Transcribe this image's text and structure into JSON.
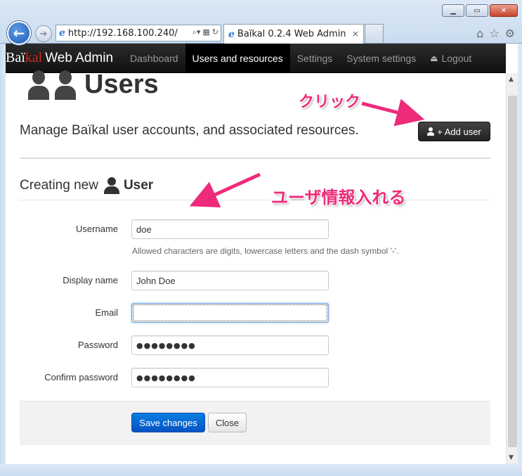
{
  "browser": {
    "address": "http://192.168.100.240/",
    "tab_title": "Baïkal 0.2.4 Web Admin",
    "tab_close": "×"
  },
  "navbar": {
    "brand_prefix": "Baï",
    "brand_accent": "kal",
    "brand_suffix": "Web Admin",
    "items": [
      {
        "label": "Dashboard",
        "active": false
      },
      {
        "label": "Users and resources",
        "active": true
      },
      {
        "label": "Settings",
        "active": false
      },
      {
        "label": "System settings",
        "active": false
      },
      {
        "label": "Logout",
        "active": false
      }
    ]
  },
  "page": {
    "title": "Users",
    "subtitle": "Manage Baïkal user accounts, and associated resources.",
    "add_user_label": "+ Add user"
  },
  "form": {
    "section_prefix": "Creating new",
    "section_strong": "User",
    "fields": {
      "username": {
        "label": "Username",
        "value": "doe",
        "help": "Allowed characters are digits, lowercase letters and the dash symbol '-'."
      },
      "display_name": {
        "label": "Display name",
        "value": "John Doe"
      },
      "email": {
        "label": "Email",
        "value": ""
      },
      "password": {
        "label": "Password",
        "value": "●●●●●●●●"
      },
      "confirm_password": {
        "label": "Confirm password",
        "value": "●●●●●●●●"
      }
    },
    "save_label": "Save changes",
    "close_label": "Close"
  },
  "annotations": {
    "click": "クリック",
    "enter_user_info": "ユーザ情報入れる"
  },
  "colors": {
    "accent_pink": "#ee2a7b",
    "brand_red": "#d12727",
    "primary_blue": "#0553c4",
    "navbar_dark": "#1b1b1b"
  }
}
